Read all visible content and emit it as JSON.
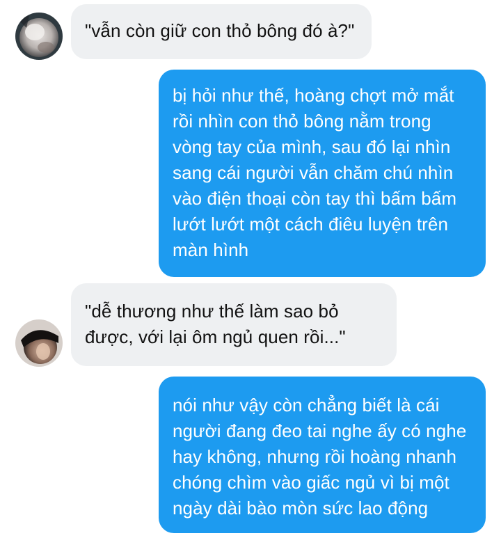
{
  "colors": {
    "incoming_bubble": "#eef0f2",
    "outgoing_bubble": "#1d9bf0",
    "incoming_text": "#111111",
    "outgoing_text": "#ffffff"
  },
  "messages": [
    {
      "direction": "incoming",
      "avatar": "user-avatar-1",
      "text": "\"vẫn còn giữ con thỏ bông đó à?\""
    },
    {
      "direction": "outgoing",
      "text": "bị hỏi như thế, hoàng chợt mở mắt\nrồi nhìn con thỏ bông nằm trong\nvòng tay của mình, sau đó lại nhìn\nsang cái người vẫn chăm chú nhìn\nvào điện thoại còn tay thì bấm bấm\nlướt lướt một cách điêu luyện trên\nmàn hình"
    },
    {
      "direction": "incoming",
      "avatar": "user-avatar-2",
      "text": "\"dễ thương như thế làm sao bỏ\nđược, với lại ôm ngủ quen rồi...\""
    },
    {
      "direction": "outgoing",
      "text": "nói như vậy còn chẳng biết là cái\nngười đang đeo tai nghe ấy có nghe\nhay không, nhưng rồi hoàng nhanh\nchóng chìm vào giấc ngủ vì bị một\nngày dài bào mòn sức lao động"
    }
  ]
}
